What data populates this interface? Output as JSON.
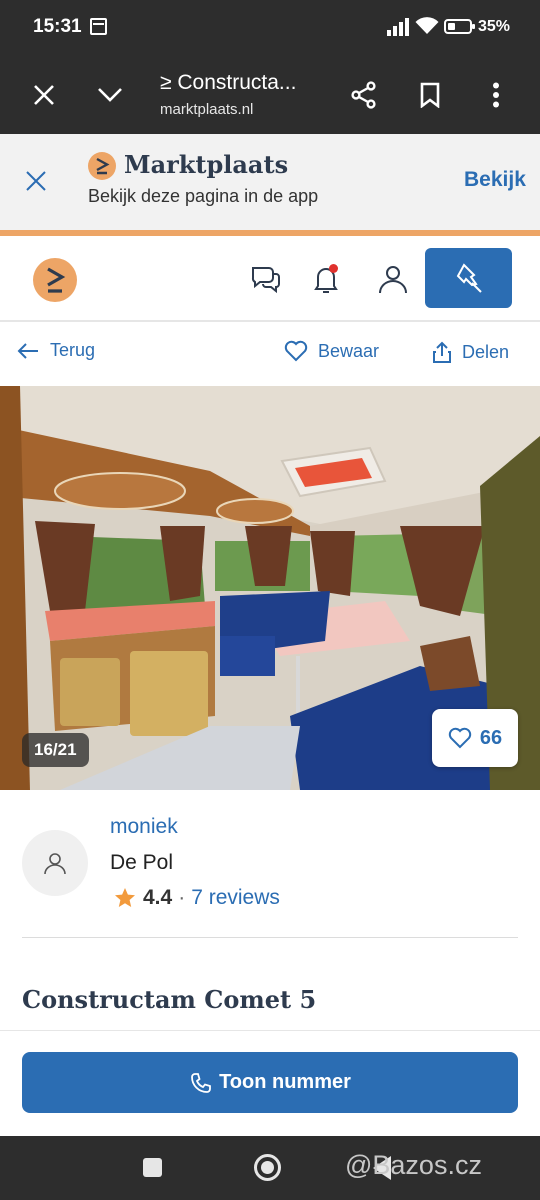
{
  "status_bar": {
    "time": "15:31",
    "battery": "35%",
    "battery_level": 0.35
  },
  "browser": {
    "title": "≥ Constructa...",
    "url": "marktplaats.nl"
  },
  "app_banner": {
    "name": "Marktplaats",
    "subtitle": "Bekijk deze pagina in de app",
    "open_label": "Bekijk"
  },
  "actions": {
    "back": "Terug",
    "save": "Bewaar",
    "share": "Delen"
  },
  "photo": {
    "counter": "16/21",
    "favorites": "66"
  },
  "seller": {
    "name": "moniek",
    "location": "De Pol",
    "rating": "4.4",
    "separator": "·",
    "reviews": "7 reviews"
  },
  "listing": {
    "title": "Constructam Comet 5"
  },
  "cta": {
    "label": "Toon nummer"
  },
  "watermark": "@Bazos.cz",
  "colors": {
    "accent": "#2b6db3",
    "brand_orange": "#eda566",
    "chrome": "#2d2d2d",
    "notification": "#e0312d",
    "rating_star": "#f29a3c"
  },
  "icons": [
    "close-icon",
    "chevron-down-icon",
    "share-icon",
    "bookmark-icon",
    "more-vert-icon",
    "chat-icon",
    "bell-icon",
    "user-icon",
    "pin-icon",
    "arrow-left-icon",
    "heart-icon",
    "phone-icon",
    "star-icon"
  ]
}
